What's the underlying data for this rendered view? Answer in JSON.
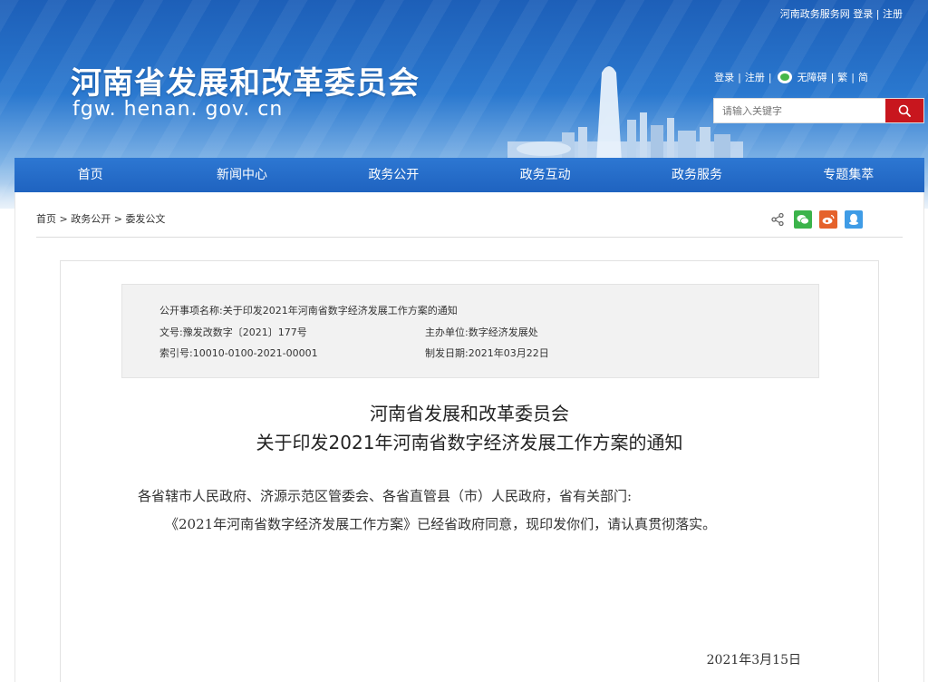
{
  "header": {
    "top_links": [
      "河南政务服务网",
      "登录",
      "注册"
    ],
    "site_title": "河南省发展和改革委员会",
    "site_domain": "fgw. henan. gov. cn",
    "util_links": {
      "login": "登录",
      "register": "注册",
      "accessibility": "无障碍",
      "traditional": "繁",
      "simplified": "简"
    },
    "search_placeholder": "请输入关键字"
  },
  "nav": {
    "items": [
      "首页",
      "新闻中心",
      "政务公开",
      "政务互动",
      "政务服务",
      "专题集萃"
    ]
  },
  "breadcrumb": {
    "items": [
      "首页",
      "政务公开",
      "委发公文"
    ],
    "sep": ">"
  },
  "meta": {
    "item_name_label": "公开事项名称:",
    "item_name_value": "关于印发2021年河南省数字经济发展工作方案的通知",
    "doc_no_label": "文号:",
    "doc_no_value": "豫发改数字〔2021〕177号",
    "host_label": "主办单位:",
    "host_value": "数字经济发展处",
    "index_label": "索引号:",
    "index_value": "10010-0100-2021-00001",
    "date_label": "制发日期:",
    "date_value": "2021年03月22日"
  },
  "document": {
    "title_line1": "河南省发展和改革委员会",
    "title_line2": "关于印发2021年河南省数字经济发展工作方案的通知",
    "salutation": "各省辖市人民政府、济源示范区管委会、各省直管县（市）人民政府，省有关部门:",
    "paragraph1": "《2021年河南省数字经济发展工作方案》已经省政府同意，现印发你们，请认真贯彻落实。",
    "date": "2021年3月15日"
  },
  "colors": {
    "nav_blue": "#2369c6",
    "search_red": "#c8161e",
    "header_blue": "#1d5fb8"
  }
}
